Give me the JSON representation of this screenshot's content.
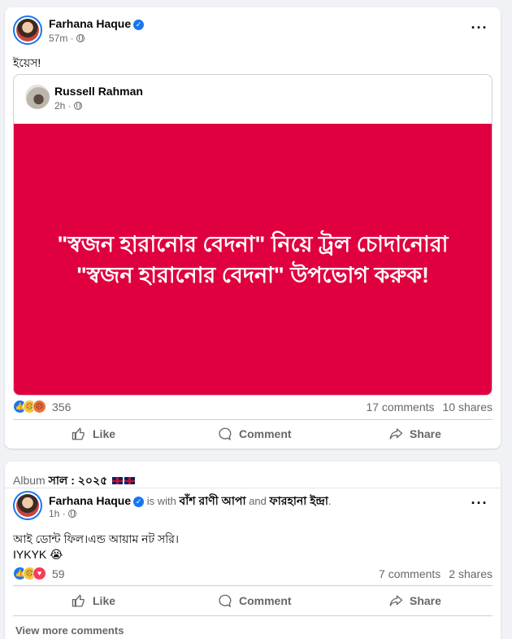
{
  "post1": {
    "author": "Farhana Haque",
    "time": "57m ·",
    "text": "ইয়েস!",
    "shared": {
      "author": "Russell Rahman",
      "time": "2h ·",
      "banner_text": "\"স্বজন হারানোর বেদনা\" নিয়ে ট্রল চোদানোরা \"স্বজন হারানোর বেদনা\" উপভোগ করুক!"
    },
    "reaction_count": "356",
    "comments": "17 comments",
    "shares": "10 shares",
    "actions": {
      "like": "Like",
      "comment": "Comment",
      "share": "Share"
    }
  },
  "post2": {
    "album_prefix": "Album",
    "album_name": "সাল : ২০২৫",
    "author": "Farhana Haque",
    "is_with": "is with",
    "with1": "বাঁশ রাণী আপা",
    "and": "and",
    "with2": "ফারহানা ইন্দ্রা",
    "period": ".",
    "time": "1h ·",
    "text": "আই ডোন্ট ফিল।এন্ড আয়াম নট সরি।",
    "text2": "IYKYK 😭",
    "reaction_count": "59",
    "comments": "7 comments",
    "shares": "2 shares",
    "actions": {
      "like": "Like",
      "comment": "Comment",
      "share": "Share"
    },
    "view_more": "View more comments"
  },
  "icons": {
    "more": "more-options-icon",
    "globe": "globe-icon",
    "like": "like-thumb-icon",
    "comment": "comment-bubble-icon",
    "share": "share-arrow-icon"
  },
  "colors": {
    "accent": "#1877f2",
    "banner": "#e0003f"
  }
}
